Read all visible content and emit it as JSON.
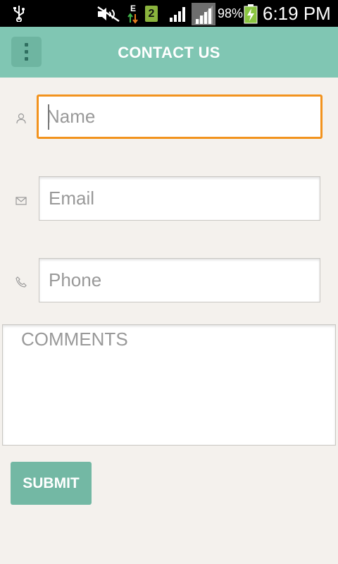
{
  "status_bar": {
    "sim_slot": "2",
    "battery_percent": "98%",
    "time": "6:19 PM",
    "icons": [
      "usb-icon",
      "no-sound-icon",
      "data-transfer-icon",
      "sim-icon",
      "signal-icon",
      "signal-strength-icon",
      "battery-charging-icon"
    ]
  },
  "app_bar": {
    "title": "CONTACT US",
    "menu_icon": "overflow-menu-icon",
    "color": "#80c6b3"
  },
  "form": {
    "name_placeholder": "Name",
    "email_placeholder": "Email",
    "phone_placeholder": "Phone",
    "comments_placeholder": "COMMENTS",
    "submit_label": "SUBMIT",
    "focused_field": "name",
    "focus_color": "#f2931e",
    "field_icons": [
      "person-icon",
      "envelope-icon",
      "phone-icon"
    ]
  },
  "colors": {
    "background": "#f4f1ed",
    "accent": "#73b8a4"
  }
}
